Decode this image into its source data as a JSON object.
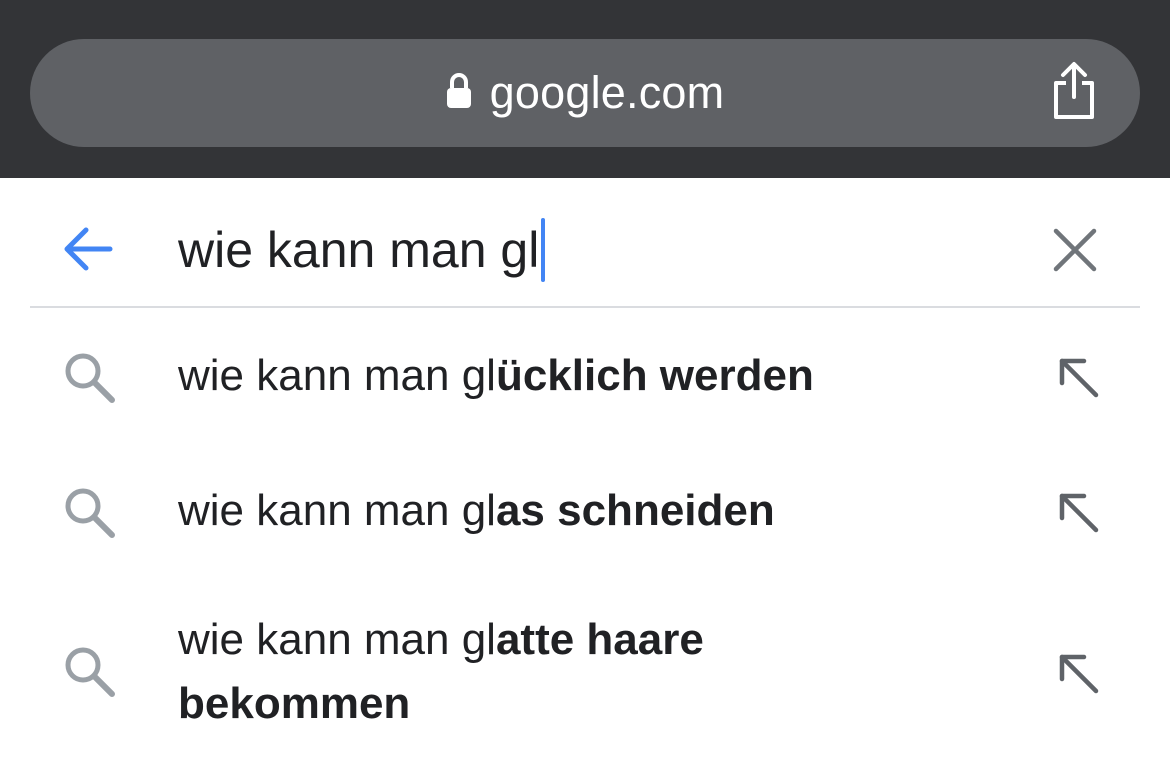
{
  "browser": {
    "url": "google.com",
    "icons": {
      "lock": "lock-icon",
      "share": "share-icon"
    }
  },
  "search": {
    "query": "wie kann man gl",
    "icons": {
      "back": "back-arrow-icon",
      "clear": "close-icon"
    }
  },
  "suggestions": [
    {
      "prefix": "wie kann man gl",
      "completion": "ücklich werden"
    },
    {
      "prefix": "wie kann man gl",
      "completion": "as schneiden"
    },
    {
      "prefix": "wie kann man gl",
      "completion": "atte haare bekommen"
    }
  ],
  "colors": {
    "topbar": "#333437",
    "url_pill": "#5f6165",
    "accent_blue": "#4285f4",
    "icon_gray": "#757575"
  }
}
